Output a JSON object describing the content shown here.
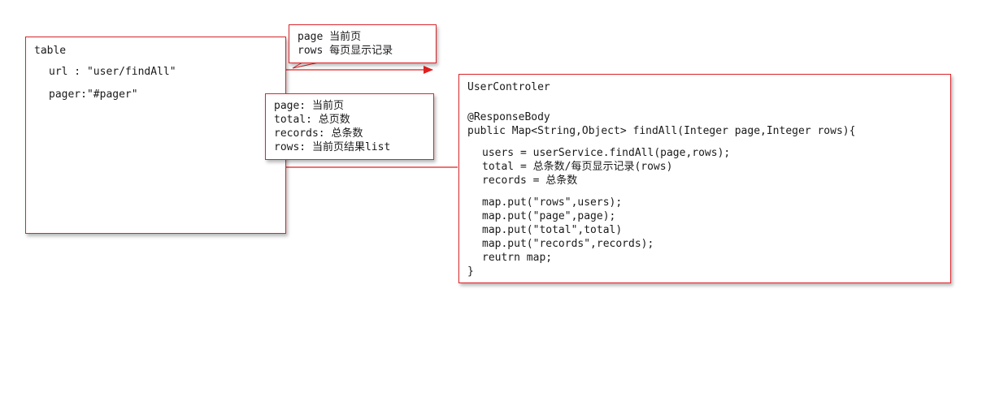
{
  "table_box": {
    "title": "table",
    "url_line": "url : \"user/findAll\"",
    "pager_line": "pager:\"#pager\""
  },
  "request_note": {
    "lines": [
      "page 当前页",
      "rows 每页显示记录"
    ]
  },
  "response_note": {
    "lines": [
      "page: 当前页",
      "total: 总页数",
      "records: 总条数",
      "rows: 当前页结果list"
    ]
  },
  "controller_box": {
    "title": "UserControler",
    "annotation": "@ResponseBody",
    "signature": "public Map<String,Object> findAll(Integer page,Integer rows){",
    "body": [
      "users = userService.findAll(page,rows);",
      "total = 总条数/每页显示记录(rows)",
      "records = 总条数",
      "map.put(\"rows\",users);",
      "map.put(\"page\",page);",
      "map.put(\"total\",total)",
      "map.put(\"records\",records);",
      "reutrn map;"
    ],
    "closing": "}"
  },
  "colors": {
    "border": "#d9262b",
    "arrow": "#e02020",
    "text": "#1a1a1a"
  }
}
